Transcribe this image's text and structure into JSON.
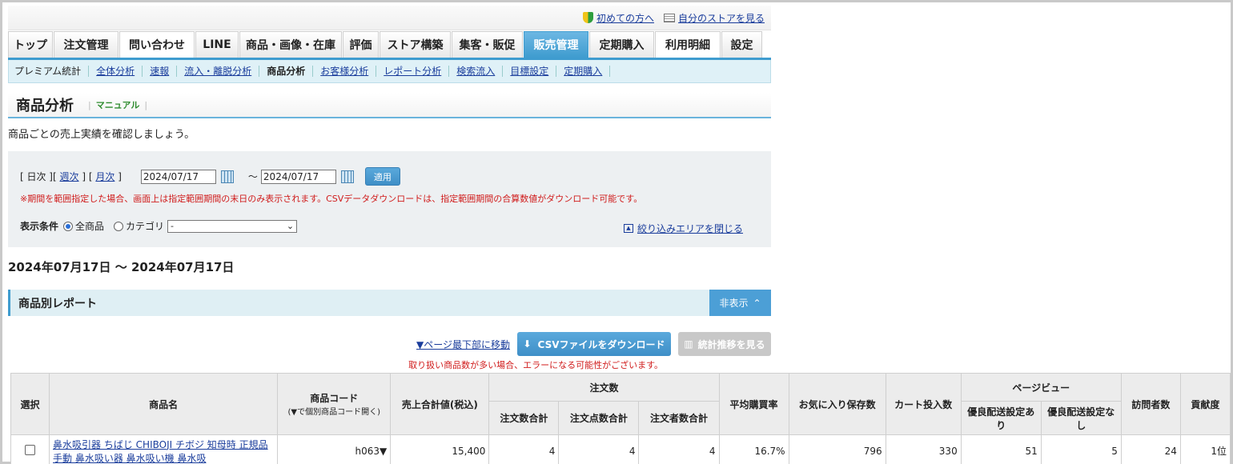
{
  "toplinks": {
    "beginner": "初めての方へ",
    "store": "自分のストアを見る"
  },
  "tabs": [
    "トップ",
    "注文管理",
    "問い合わせ",
    "LINE",
    "商品・画像・在庫",
    "評価",
    "ストア構築",
    "集客・販促",
    "販売管理",
    "定期購入",
    "利用明細",
    "設定"
  ],
  "subnav": [
    "プレミアム統計",
    "全体分析",
    "速報",
    "流入・離脱分析",
    "商品分析",
    "お客様分析",
    "レポート分析",
    "検索流入",
    "目標設定",
    "定期購入"
  ],
  "page": {
    "title": "商品分析",
    "manual": "マニュアル",
    "desc": "商品ごとの売上実績を確認しましょう。"
  },
  "filter": {
    "daily": "[ 日次 ]",
    "weekly_open": "[",
    "weekly": "週次",
    "weekly_close": "] [",
    "monthly": "月次",
    "monthly_close": "]",
    "date_from": "2024/07/17",
    "tilde": "～",
    "date_to": "2024/07/17",
    "apply": "適用",
    "note": "※期間を範囲指定した場合、画面上は指定範囲期間の末日のみ表示されます。CSVデータダウンロードは、指定範囲期間の合算数値がダウンロード可能です。",
    "cond_label": "表示条件",
    "opt_all": "全商品",
    "opt_cat": "カテゴリ",
    "cat_value": "-",
    "close": "絞り込みエリアを閉じる"
  },
  "range": "2024年07月17日 ～ 2024年07月17日",
  "section": {
    "title": "商品別レポート",
    "hide": "非表示"
  },
  "actions": {
    "jump": "▼ページ最下部に移動",
    "csv": "CSVファイルをダウンロード",
    "stats": "統計推移を見る",
    "warn": "取り扱い商品数が多い場合、エラーになる可能性がございます。"
  },
  "table": {
    "h_select": "選択",
    "h_name": "商品名",
    "h_code": "商品コード",
    "h_code_sub": "(▼で個別商品コード開く)",
    "h_sales": "売上合計値(税込)",
    "h_orders": "注文数",
    "h_order_total": "注文数合計",
    "h_order_items": "注文点数合計",
    "h_orderers": "注文者数合計",
    "h_avg_rate": "平均購買率",
    "h_fav": "お気に入り保存数",
    "h_cart": "カート投入数",
    "h_pv": "ページビュー",
    "h_pv_yes": "優良配送設定あり",
    "h_pv_no": "優良配送設定なし",
    "h_visitors": "訪問者数",
    "h_contrib": "貢献度",
    "row": {
      "name": "鼻水吸引器 ちばじ CHIBOJI チボジ 知母時 正規品 手動 鼻水吸い器 鼻水吸い機 鼻水吸",
      "code": "h063▼",
      "sales": "15,400",
      "order_total": "4",
      "order_items": "4",
      "orderers": "4",
      "avg_rate": "16.7%",
      "fav": "796",
      "cart": "330",
      "pv_yes": "51",
      "pv_no": "5",
      "visitors": "24",
      "contrib": "1位"
    }
  }
}
